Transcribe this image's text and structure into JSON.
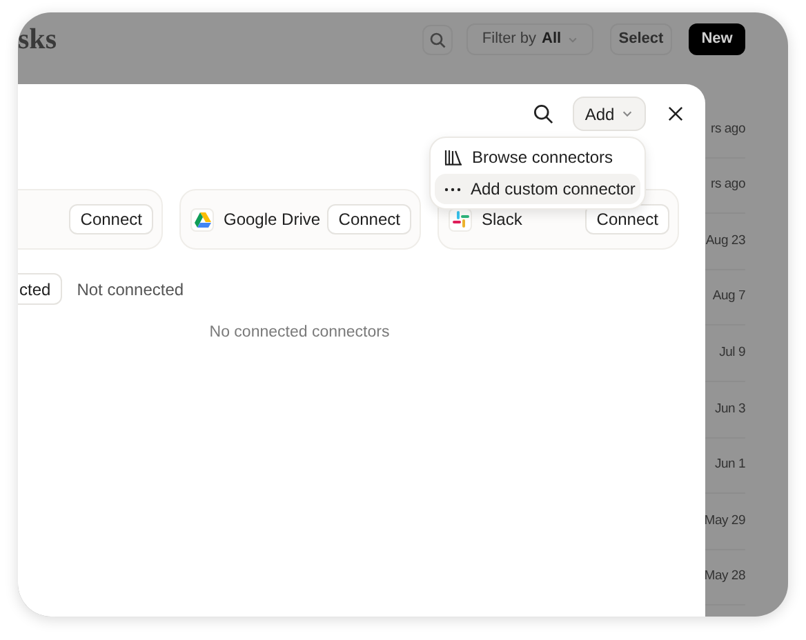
{
  "background_page": {
    "title": "sks",
    "filter": {
      "label": "Filter by",
      "value": "All"
    },
    "buttons": [
      "Select",
      "New"
    ],
    "dates": [
      "rs ago",
      "rs ago",
      "Aug 23",
      "Aug 7",
      "Jul 9",
      "Jun 3",
      "Jun 1",
      "May 29",
      "May 28"
    ]
  },
  "modal": {
    "add_button": "Add",
    "menu": [
      {
        "label": "Browse connectors",
        "selected": false
      },
      {
        "label": "Add custom connector",
        "selected": true
      }
    ],
    "connectors": [
      {
        "button": "Connect"
      },
      {
        "name": "Google Drive",
        "button": "Connect"
      },
      {
        "name": "Slack",
        "button": "Connect"
      }
    ],
    "tabs": [
      {
        "label": "cted",
        "selected": true
      },
      {
        "label": "Not connected",
        "selected": false
      }
    ],
    "empty_message": "No connected connectors"
  }
}
